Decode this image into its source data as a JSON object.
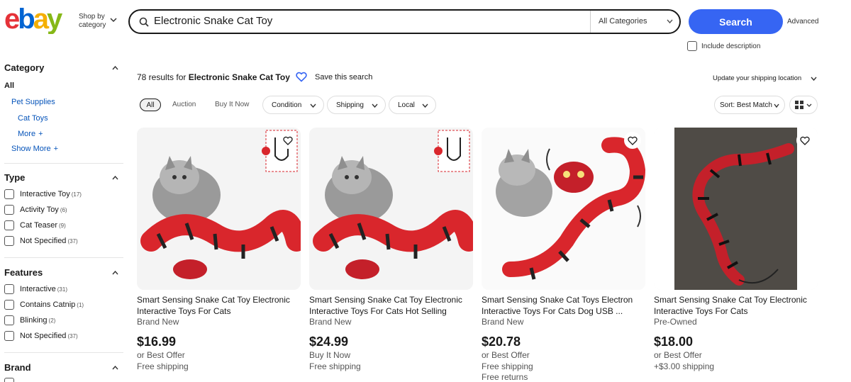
{
  "header": {
    "shop_by_category": "Shop by category",
    "search_value": "Electronic Snake Cat Toy",
    "category_select": "All Categories",
    "search_button": "Search",
    "advanced": "Advanced",
    "include_description": "Include description"
  },
  "sidebar": {
    "category_heading": "Category",
    "all_label": "All",
    "pet_supplies": "Pet Supplies",
    "cat_toys": "Cat Toys",
    "more": "More",
    "show_more": "Show More",
    "type_heading": "Type",
    "type_items": [
      {
        "label": "Interactive Toy",
        "count": "(17)"
      },
      {
        "label": "Activity Toy",
        "count": "(6)"
      },
      {
        "label": "Cat Teaser",
        "count": "(9)"
      },
      {
        "label": "Not Specified",
        "count": "(37)"
      }
    ],
    "features_heading": "Features",
    "features_items": [
      {
        "label": "Interactive",
        "count": "(31)"
      },
      {
        "label": "Contains Catnip",
        "count": "(1)"
      },
      {
        "label": "Blinking",
        "count": "(2)"
      },
      {
        "label": "Not Specified",
        "count": "(37)"
      }
    ],
    "brand_heading": "Brand"
  },
  "results": {
    "count_text": "78 results for",
    "query": "Electronic Snake Cat Toy",
    "save_search": "Save this search",
    "shipping_location": "Update your shipping location"
  },
  "filters": {
    "all": "All",
    "auction": "Auction",
    "buy_it_now": "Buy It Now",
    "condition": "Condition",
    "shipping": "Shipping",
    "local": "Local",
    "sort": "Sort: Best Match"
  },
  "products": [
    {
      "title": "Smart Sensing Snake Cat Toy Electronic Interactive Toys For Cats",
      "condition": "Brand New",
      "price": "$16.99",
      "line1": "or Best Offer",
      "line2": "Free shipping",
      "line3": ""
    },
    {
      "title": "Smart Sensing Snake Cat Toy Electronic Interactive Toys For Cats Hot Selling",
      "condition": "Brand New",
      "price": "$24.99",
      "line1": "Buy It Now",
      "line2": "Free shipping",
      "line3": ""
    },
    {
      "title": "Smart Sensing Snake Cat Toys Electron Interactive Toys For Cats Dog USB ...",
      "condition": "Brand New",
      "price": "$20.78",
      "line1": "or Best Offer",
      "line2": "Free shipping",
      "line3": "Free returns"
    },
    {
      "title": "Smart Sensing Snake Cat Toy Electronic Interactive Toys For Cats",
      "condition": "Pre-Owned",
      "price": "$18.00",
      "line1": "or Best Offer",
      "line2": "+$3.00 shipping",
      "line3": ""
    }
  ],
  "colors": {
    "ebay_red": "#e53238",
    "ebay_blue": "#0064d2",
    "ebay_yellow": "#f5af02",
    "ebay_green": "#86b817",
    "search_button": "#3665f3",
    "link": "#0654ba"
  }
}
